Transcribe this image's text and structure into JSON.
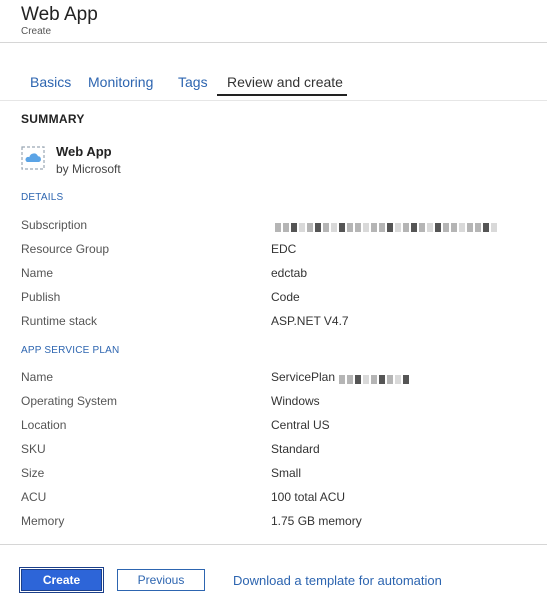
{
  "header": {
    "title": "Web App",
    "subtitle": "Create"
  },
  "tabs": [
    {
      "label": "Basics",
      "active": false
    },
    {
      "label": "Monitoring",
      "active": false
    },
    {
      "label": "Tags",
      "active": false
    },
    {
      "label": "Review and create",
      "active": true
    }
  ],
  "summary": {
    "heading": "SUMMARY",
    "app_icon": "web-app-cloud-icon",
    "app_name": "Web App",
    "publisher": "by Microsoft"
  },
  "details": {
    "heading": "DETAILS",
    "rows": [
      {
        "label": "Subscription",
        "value": "",
        "redacted": true
      },
      {
        "label": "Resource Group",
        "value": "EDC"
      },
      {
        "label": "Name",
        "value": "edctab"
      },
      {
        "label": "Publish",
        "value": "Code"
      },
      {
        "label": "Runtime stack",
        "value": "ASP.NET V4.7"
      }
    ]
  },
  "plan": {
    "heading": "APP SERVICE PLAN",
    "rows": [
      {
        "label": "Name",
        "value": "ServicePlan",
        "redacted": true
      },
      {
        "label": "Operating System",
        "value": "Windows"
      },
      {
        "label": "Location",
        "value": "Central US"
      },
      {
        "label": "SKU",
        "value": "Standard"
      },
      {
        "label": "Size",
        "value": "Small"
      },
      {
        "label": "ACU",
        "value": "100 total ACU"
      },
      {
        "label": "Memory",
        "value": "1.75 GB memory"
      }
    ]
  },
  "footer": {
    "create_label": "Create",
    "previous_label": "Previous",
    "template_link": "Download a template for automation"
  },
  "colors": {
    "accent": "#2d65b0",
    "primary_button": "#2d65d8"
  }
}
